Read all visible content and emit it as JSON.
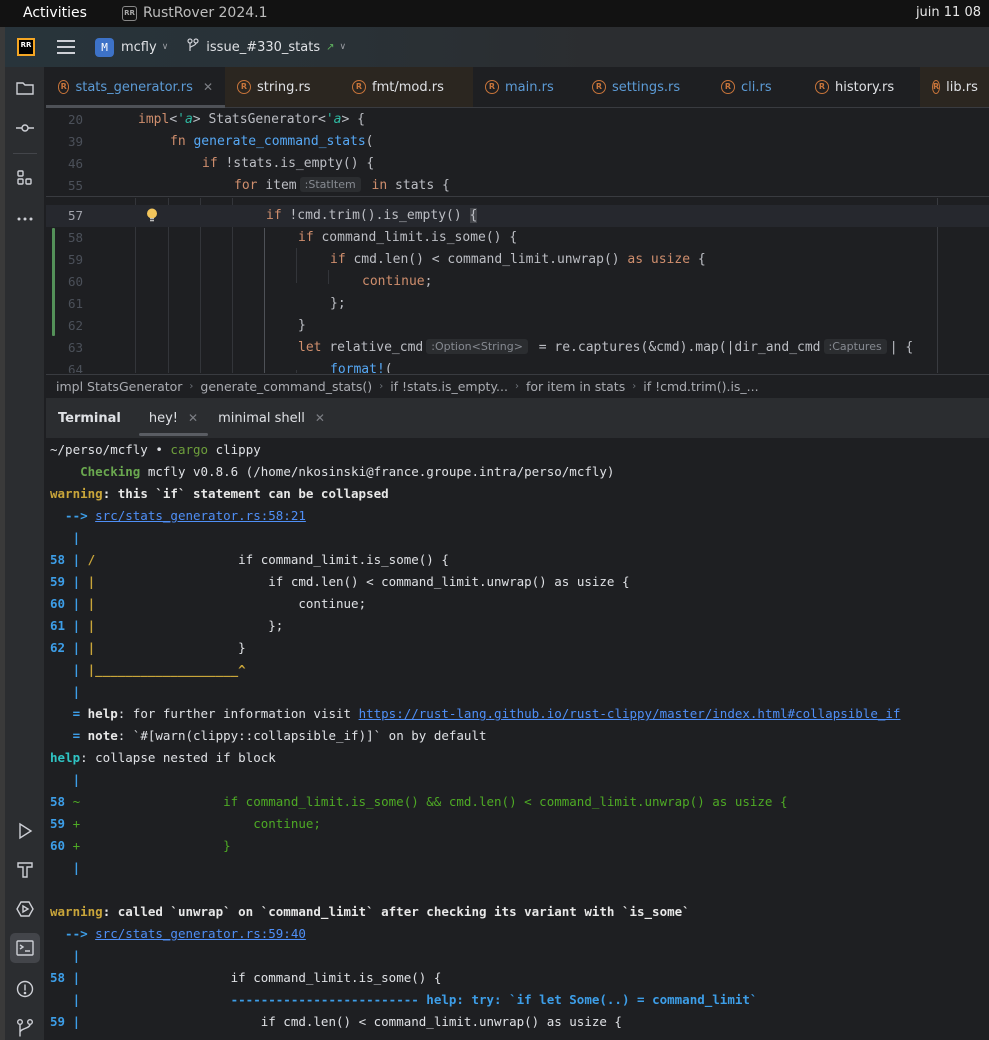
{
  "system_bar": {
    "activities": "Activities",
    "app_name": "RustRover 2024.1",
    "app_icon": "rr-icon",
    "clock": "juin 11  08"
  },
  "header": {
    "logo": "RR",
    "project_badge": "M",
    "project_name": "mcfly",
    "branch_name": "issue_#330_stats",
    "branch_status_icon": "arrow-up-right-icon"
  },
  "left_toolbar": {
    "top": [
      "folder-icon",
      "commit-icon",
      "structure-icon",
      "more-icon"
    ],
    "bottom": [
      "run-icon",
      "build-icon",
      "services-icon",
      "terminal-icon",
      "problems-icon",
      "git-icon"
    ],
    "active": "terminal-icon"
  },
  "editor_tabs": [
    {
      "label": "stats_generator.rs",
      "active": true,
      "closable": true
    },
    {
      "label": "string.rs",
      "active": false
    },
    {
      "label": "fmt/mod.rs",
      "active": false
    },
    {
      "label": "main.rs",
      "active": false
    },
    {
      "label": "settings.rs",
      "active": false
    },
    {
      "label": "cli.rs",
      "active": false
    },
    {
      "label": "history.rs",
      "active": false
    },
    {
      "label": "lib.rs",
      "active": false
    }
  ],
  "editor": {
    "sticky_lines": [
      {
        "ln": "20",
        "parts": [
          [
            "kw",
            "impl"
          ],
          [
            "",
            "<"
          ],
          [
            "lt",
            "'a"
          ],
          [
            "",
            "> StatsGenerator<"
          ],
          [
            "lt",
            "'a"
          ],
          [
            "",
            "> {"
          ]
        ]
      },
      {
        "ln": "39",
        "parts": [
          [
            "kw",
            "fn "
          ],
          [
            "fn",
            "generate_command_stats"
          ],
          [
            "",
            "("
          ]
        ]
      },
      {
        "ln": "46",
        "parts": [
          [
            "kw",
            "if "
          ],
          [
            "",
            "!stats.is_empty() {"
          ]
        ]
      },
      {
        "ln": "55",
        "parts": [
          [
            "kw",
            "for "
          ],
          [
            "",
            "item"
          ],
          [
            "hint",
            ":StatItem"
          ],
          [
            "kw",
            " in "
          ],
          [
            "",
            "stats {"
          ]
        ]
      }
    ],
    "lines": [
      {
        "ln": "57",
        "current": true,
        "parts": [
          [
            "kw",
            "if "
          ],
          [
            "",
            "!cmd.trim().is_empty() "
          ],
          [
            "brace",
            "{"
          ]
        ]
      },
      {
        "ln": "58",
        "parts": [
          [
            "kw",
            "if "
          ],
          [
            "",
            "command_limit.is_some() {"
          ]
        ]
      },
      {
        "ln": "59",
        "parts": [
          [
            "kw",
            "if "
          ],
          [
            "",
            "cmd.len() < command_limit.unwrap() "
          ],
          [
            "kw",
            "as usize "
          ],
          [
            "",
            "{"
          ]
        ]
      },
      {
        "ln": "60",
        "parts": [
          [
            "kw",
            "continue"
          ],
          [
            "",
            ";"
          ]
        ]
      },
      {
        "ln": "61",
        "parts": [
          [
            "",
            "};"
          ]
        ]
      },
      {
        "ln": "62",
        "parts": [
          [
            "",
            "}"
          ]
        ]
      },
      {
        "ln": "63",
        "parts": [
          [
            "kw",
            "let "
          ],
          [
            "",
            "relative_cmd"
          ],
          [
            "hint",
            ":Option<String>"
          ],
          [
            "",
            " = re.captures(&cmd).map(|dir_and_cmd"
          ],
          [
            "hint",
            ":Captures"
          ],
          [
            "",
            "| {"
          ]
        ]
      },
      {
        "ln": "64",
        "parts": [
          [
            "mac",
            "format!"
          ],
          [
            "",
            "("
          ]
        ]
      }
    ]
  },
  "breadcrumbs": [
    "impl StatsGenerator",
    "generate_command_stats()",
    "if !stats.is_empty...",
    "for item in stats",
    "if !cmd.trim().is_..."
  ],
  "terminal": {
    "title": "Terminal",
    "tabs": [
      {
        "label": "hey!",
        "active": true
      },
      {
        "label": "minimal shell",
        "active": false
      }
    ],
    "lines": [
      [
        [
          "",
          "~/perso/mcfly • "
        ],
        [
          "cargo",
          "cargo"
        ],
        [
          "",
          " clippy"
        ]
      ],
      [
        [
          "",
          "    "
        ],
        [
          "greenb",
          "Checking"
        ],
        [
          "",
          " mcfly v0.8.6 (/home/nkosinski@france.groupe.intra/perso/mcfly)"
        ]
      ],
      [
        [
          "yellow",
          "warning"
        ],
        [
          "bold",
          ": this `if` statement can be collapsed"
        ]
      ],
      [
        [
          "blue",
          "  --> "
        ],
        [
          "link",
          "src/stats_generator.rs:58:21"
        ]
      ],
      [
        [
          "blue",
          "   |"
        ]
      ],
      [
        [
          "blue",
          "58 | "
        ],
        [
          "yellow",
          "/"
        ],
        [
          "",
          "                   if command_limit.is_some() {"
        ]
      ],
      [
        [
          "blue",
          "59 | "
        ],
        [
          "yellow",
          "|"
        ],
        [
          "",
          "                       if cmd.len() < command_limit.unwrap() as usize {"
        ]
      ],
      [
        [
          "blue",
          "60 | "
        ],
        [
          "yellow",
          "|"
        ],
        [
          "",
          "                           continue;"
        ]
      ],
      [
        [
          "blue",
          "61 | "
        ],
        [
          "yellow",
          "|"
        ],
        [
          "",
          "                       };"
        ]
      ],
      [
        [
          "blue",
          "62 | "
        ],
        [
          "yellow",
          "|"
        ],
        [
          "",
          "                   }"
        ]
      ],
      [
        [
          "blue",
          "   | "
        ],
        [
          "yellow",
          "|___________________^"
        ]
      ],
      [
        [
          "blue",
          "   |"
        ]
      ],
      [
        [
          "blue",
          "   = "
        ],
        [
          "bold",
          "help"
        ],
        [
          "",
          ": for further information visit "
        ],
        [
          "link",
          "https://rust-lang.github.io/rust-clippy/master/index.html#collapsible_if"
        ]
      ],
      [
        [
          "blue",
          "   = "
        ],
        [
          "bold",
          "note"
        ],
        [
          "",
          ": `#[warn(clippy::collapsible_if)]` on by default"
        ]
      ],
      [
        [
          "cyan",
          "help"
        ],
        [
          "",
          ": collapse nested if block"
        ]
      ],
      [
        [
          "blue",
          "   |"
        ]
      ],
      [
        [
          "blue",
          "58 "
        ],
        [
          "green",
          "~                   if command_limit.is_some() && cmd.len() < command_limit.unwrap() as usize {"
        ]
      ],
      [
        [
          "blue",
          "59 "
        ],
        [
          "green",
          "+                       continue;"
        ]
      ],
      [
        [
          "blue",
          "60 "
        ],
        [
          "green",
          "+                   }"
        ]
      ],
      [
        [
          "blue",
          "   |"
        ]
      ],
      [
        [
          "",
          ""
        ]
      ],
      [
        [
          "yellow",
          "warning"
        ],
        [
          "bold",
          ": called `unwrap` on `command_limit` after checking its variant with `is_some`"
        ]
      ],
      [
        [
          "blue",
          "  --> "
        ],
        [
          "link",
          "src/stats_generator.rs:59:40"
        ]
      ],
      [
        [
          "blue",
          "   |"
        ]
      ],
      [
        [
          "blue",
          "58 | "
        ],
        [
          "",
          "                   if command_limit.is_some() {"
        ]
      ],
      [
        [
          "blue",
          "   | "
        ],
        [
          "help",
          "                   ------------------------- help: try: `if let Some(..) = command_limit`"
        ]
      ],
      [
        [
          "blue",
          "59 | "
        ],
        [
          "",
          "                       if cmd.len() < command_limit.unwrap() as usize {"
        ]
      ]
    ]
  }
}
